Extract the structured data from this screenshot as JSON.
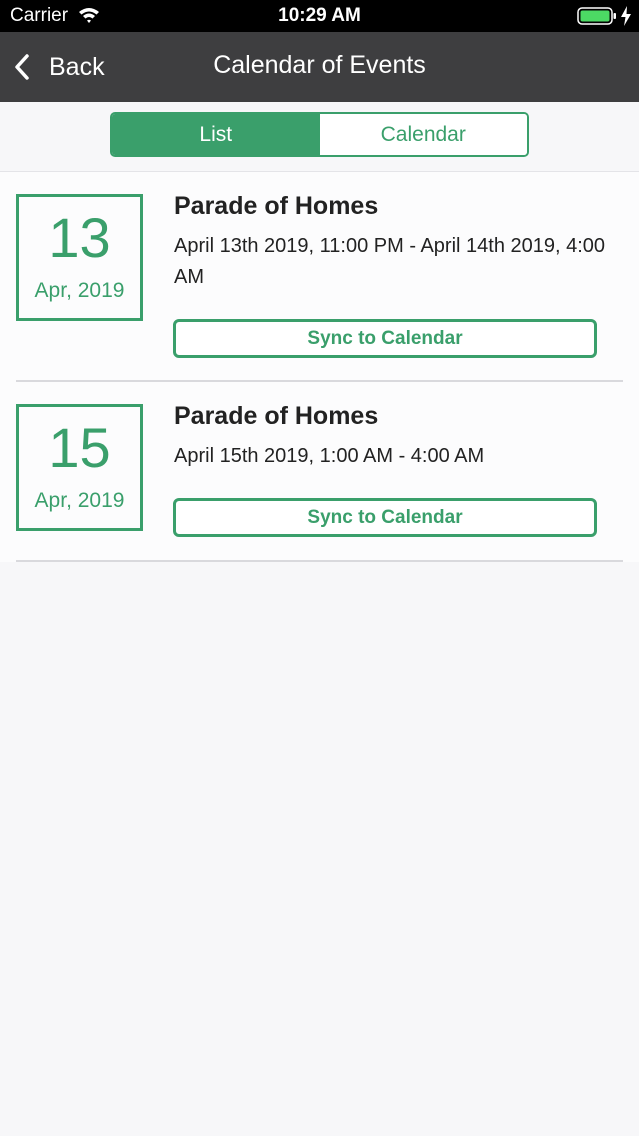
{
  "status_bar": {
    "carrier": "Carrier",
    "time": "10:29 AM",
    "battery_color": "#4cd964"
  },
  "nav": {
    "back_label": "Back",
    "title": "Calendar of Events"
  },
  "segments": {
    "list_label": "List",
    "calendar_label": "Calendar",
    "selected": "List"
  },
  "events": [
    {
      "day": "13",
      "month_year": "Apr, 2019",
      "title": "Parade of Homes",
      "time": "April 13th 2019, 11:00 PM - April 14th 2019, 4:00 AM",
      "sync_label": "Sync to Calendar"
    },
    {
      "day": "15",
      "month_year": "Apr, 2019",
      "title": "Parade of Homes",
      "time": "April 15th 2019, 1:00 AM - 4:00 AM",
      "sync_label": "Sync to Calendar"
    }
  ],
  "colors": {
    "accent": "#3a9f6b",
    "nav_background": "#3e3e40"
  }
}
